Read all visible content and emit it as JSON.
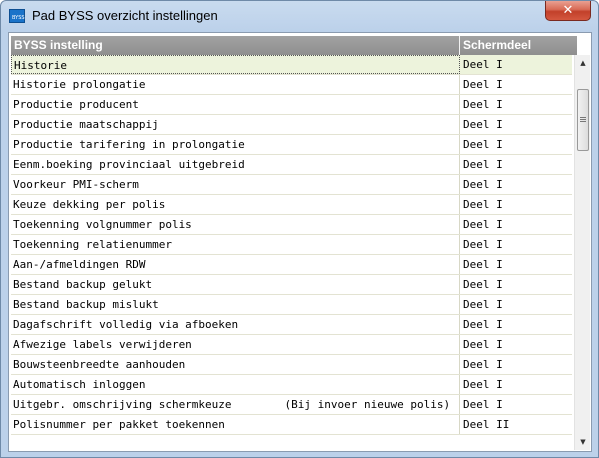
{
  "window": {
    "title": "Pad BYSS overzicht instellingen",
    "app_icon_text": "BYSS",
    "close_glyph": "✕"
  },
  "table": {
    "columns": [
      "BYSS instelling",
      "Schermdeel"
    ],
    "rows": [
      {
        "name": "Historie",
        "part": "Deel I"
      },
      {
        "name": "Historie prolongatie",
        "part": "Deel I"
      },
      {
        "name": "Productie producent",
        "part": "Deel I"
      },
      {
        "name": "Productie maatschappij",
        "part": "Deel I"
      },
      {
        "name": "Productie tarifering in prolongatie",
        "part": "Deel I"
      },
      {
        "name": "Eenm.boeking provinciaal uitgebreid",
        "part": "Deel I"
      },
      {
        "name": "Voorkeur PMI-scherm",
        "part": "Deel I"
      },
      {
        "name": "Keuze dekking per polis",
        "part": "Deel I"
      },
      {
        "name": "Toekenning volgnummer polis",
        "part": "Deel I"
      },
      {
        "name": "Toekenning relatienummer",
        "part": "Deel I"
      },
      {
        "name": "Aan-/afmeldingen RDW",
        "part": "Deel I"
      },
      {
        "name": "Bestand backup gelukt",
        "part": "Deel I"
      },
      {
        "name": "Bestand backup mislukt",
        "part": "Deel I"
      },
      {
        "name": "Dagafschrift volledig via afboeken",
        "part": "Deel I"
      },
      {
        "name": "Afwezige labels verwijderen",
        "part": "Deel I"
      },
      {
        "name": "Bouwsteenbreedte aanhouden",
        "part": "Deel I"
      },
      {
        "name": "Automatisch inloggen",
        "part": "Deel I"
      },
      {
        "name": "Uitgebr. omschrijving schermkeuze        (Bij invoer nieuwe polis)",
        "part": "Deel I"
      },
      {
        "name": "Polisnummer per pakket toekennen",
        "part": "Deel II"
      }
    ],
    "selected_index": 0
  },
  "scrollbar": {
    "up_glyph": "▲",
    "down_glyph": "▼",
    "position": 0.1
  }
}
